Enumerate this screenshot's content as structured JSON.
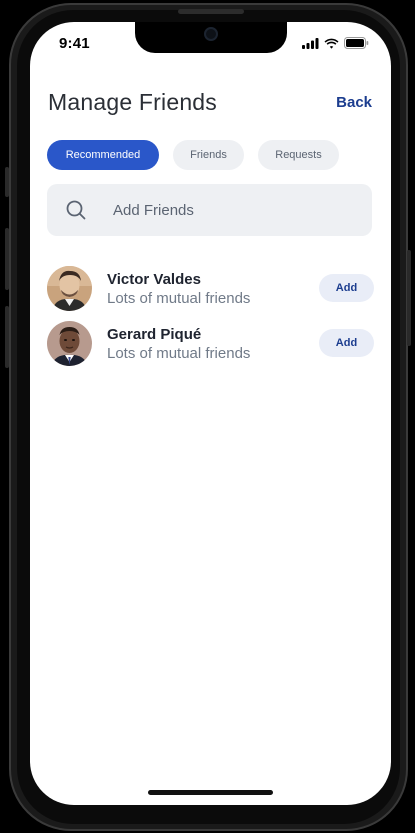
{
  "status_bar": {
    "time": "9:41",
    "icons": [
      "cellular-signal-icon",
      "wifi-icon",
      "battery-icon"
    ]
  },
  "header": {
    "title": "Manage Friends",
    "back_label": "Back"
  },
  "tabs": [
    {
      "label": "Recommended",
      "active": true
    },
    {
      "label": "Friends",
      "active": false
    },
    {
      "label": "Requests",
      "active": false
    }
  ],
  "search": {
    "placeholder": "Add Friends",
    "value": ""
  },
  "friends": [
    {
      "name": "Victor Valdes",
      "subtitle": "Lots of mutual friends",
      "action_label": "Add"
    },
    {
      "name": "Gerard Piqué",
      "subtitle": "Lots of mutual friends",
      "action_label": "Add"
    }
  ],
  "colors": {
    "accent": "#2a57c9",
    "link": "#1c3d8f",
    "chip_bg": "#eef0f3",
    "add_bg": "#e9edf7"
  }
}
